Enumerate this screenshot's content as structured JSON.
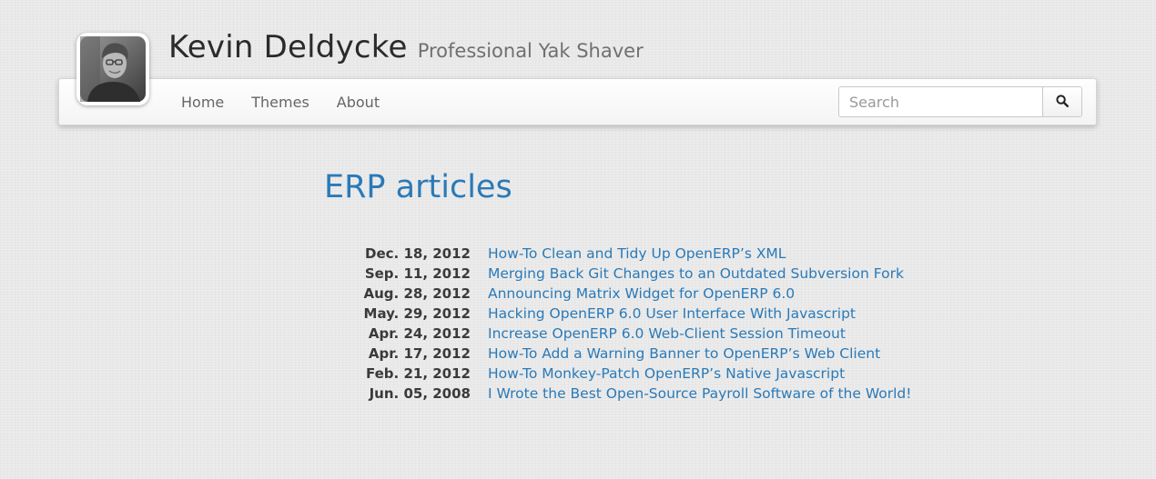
{
  "header": {
    "name": "Kevin Deldycke",
    "tagline": "Professional Yak Shaver"
  },
  "nav": {
    "items": [
      {
        "label": "Home"
      },
      {
        "label": "Themes"
      },
      {
        "label": "About"
      }
    ]
  },
  "search": {
    "placeholder": "Search",
    "value": "",
    "icon": "search-icon"
  },
  "page": {
    "title": "ERP articles"
  },
  "articles": [
    {
      "date": "Dec. 18, 2012",
      "title": "How-To Clean and Tidy Up OpenERP’s XML"
    },
    {
      "date": "Sep. 11, 2012",
      "title": "Merging Back Git Changes to an Outdated Subversion Fork"
    },
    {
      "date": "Aug. 28, 2012",
      "title": "Announcing Matrix Widget for OpenERP 6.0"
    },
    {
      "date": "May. 29, 2012",
      "title": "Hacking OpenERP 6.0 User Interface With Javascript"
    },
    {
      "date": "Apr. 24, 2012",
      "title": "Increase OpenERP 6.0 Web-Client Session Timeout"
    },
    {
      "date": "Apr. 17, 2012",
      "title": "How-To Add a Warning Banner to OpenERP’s Web Client"
    },
    {
      "date": "Feb. 21, 2012",
      "title": "How-To Monkey-Patch OpenERP’s Native Javascript"
    },
    {
      "date": "Jun. 05, 2008",
      "title": "I Wrote the Best Open-Source Payroll Software of the World!"
    }
  ],
  "colors": {
    "link": "#2a7ab8",
    "background": "#e9e9e9"
  }
}
